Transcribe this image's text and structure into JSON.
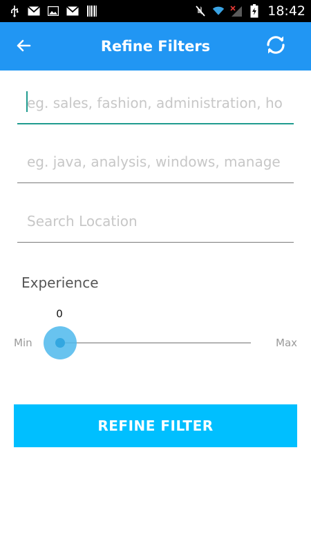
{
  "status_bar": {
    "left_icons": [
      "usb-icon",
      "gmail-icon",
      "image-icon",
      "gmail-icon",
      "barcode-icon"
    ],
    "right_icons": [
      "mute-icon",
      "wifi-icon",
      "no-signal-icon",
      "battery-charging-icon"
    ],
    "time": "18:42"
  },
  "appbar": {
    "title": "Refine Filters",
    "back_icon": "arrow-left-icon",
    "refresh_icon": "refresh-icon"
  },
  "form": {
    "industry_placeholder": "eg. sales, fashion, administration, ho",
    "skills_placeholder": "eg. java, analysis, windows, manage",
    "location_placeholder": "Search Location"
  },
  "experience": {
    "label": "Experience",
    "value": "0",
    "min_label": "Min",
    "max_label": "Max",
    "level": 0
  },
  "button": {
    "label": "REFINE FILTER"
  },
  "colors": {
    "primary": "#2196F3",
    "button": "#00BFFF",
    "accent": "#1F9B8F",
    "thumb": "#4DB8EC",
    "thumb_dot": "#33A7E0"
  }
}
